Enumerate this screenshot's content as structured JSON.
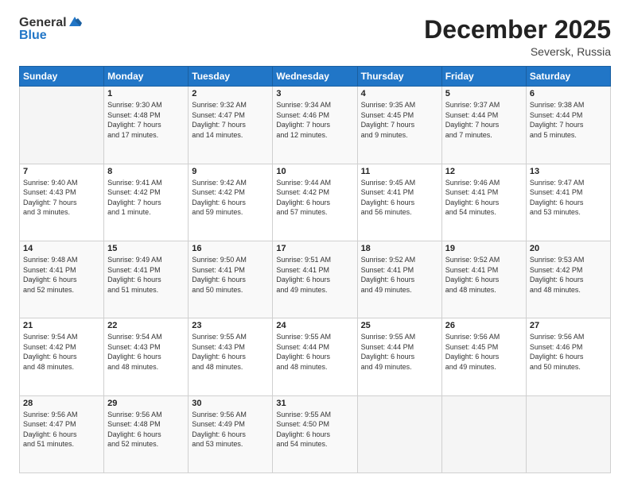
{
  "header": {
    "logo_general": "General",
    "logo_blue": "Blue",
    "month_title": "December 2025",
    "location": "Seversk, Russia"
  },
  "days_of_week": [
    "Sunday",
    "Monday",
    "Tuesday",
    "Wednesday",
    "Thursday",
    "Friday",
    "Saturday"
  ],
  "weeks": [
    [
      {
        "day": "",
        "sunrise": "",
        "sunset": "",
        "daylight": ""
      },
      {
        "day": "1",
        "sunrise": "Sunrise: 9:30 AM",
        "sunset": "Sunset: 4:48 PM",
        "daylight": "Daylight: 7 hours and 17 minutes."
      },
      {
        "day": "2",
        "sunrise": "Sunrise: 9:32 AM",
        "sunset": "Sunset: 4:47 PM",
        "daylight": "Daylight: 7 hours and 14 minutes."
      },
      {
        "day": "3",
        "sunrise": "Sunrise: 9:34 AM",
        "sunset": "Sunset: 4:46 PM",
        "daylight": "Daylight: 7 hours and 12 minutes."
      },
      {
        "day": "4",
        "sunrise": "Sunrise: 9:35 AM",
        "sunset": "Sunset: 4:45 PM",
        "daylight": "Daylight: 7 hours and 9 minutes."
      },
      {
        "day": "5",
        "sunrise": "Sunrise: 9:37 AM",
        "sunset": "Sunset: 4:44 PM",
        "daylight": "Daylight: 7 hours and 7 minutes."
      },
      {
        "day": "6",
        "sunrise": "Sunrise: 9:38 AM",
        "sunset": "Sunset: 4:44 PM",
        "daylight": "Daylight: 7 hours and 5 minutes."
      }
    ],
    [
      {
        "day": "7",
        "sunrise": "Sunrise: 9:40 AM",
        "sunset": "Sunset: 4:43 PM",
        "daylight": "Daylight: 7 hours and 3 minutes."
      },
      {
        "day": "8",
        "sunrise": "Sunrise: 9:41 AM",
        "sunset": "Sunset: 4:42 PM",
        "daylight": "Daylight: 7 hours and 1 minute."
      },
      {
        "day": "9",
        "sunrise": "Sunrise: 9:42 AM",
        "sunset": "Sunset: 4:42 PM",
        "daylight": "Daylight: 6 hours and 59 minutes."
      },
      {
        "day": "10",
        "sunrise": "Sunrise: 9:44 AM",
        "sunset": "Sunset: 4:42 PM",
        "daylight": "Daylight: 6 hours and 57 minutes."
      },
      {
        "day": "11",
        "sunrise": "Sunrise: 9:45 AM",
        "sunset": "Sunset: 4:41 PM",
        "daylight": "Daylight: 6 hours and 56 minutes."
      },
      {
        "day": "12",
        "sunrise": "Sunrise: 9:46 AM",
        "sunset": "Sunset: 4:41 PM",
        "daylight": "Daylight: 6 hours and 54 minutes."
      },
      {
        "day": "13",
        "sunrise": "Sunrise: 9:47 AM",
        "sunset": "Sunset: 4:41 PM",
        "daylight": "Daylight: 6 hours and 53 minutes."
      }
    ],
    [
      {
        "day": "14",
        "sunrise": "Sunrise: 9:48 AM",
        "sunset": "Sunset: 4:41 PM",
        "daylight": "Daylight: 6 hours and 52 minutes."
      },
      {
        "day": "15",
        "sunrise": "Sunrise: 9:49 AM",
        "sunset": "Sunset: 4:41 PM",
        "daylight": "Daylight: 6 hours and 51 minutes."
      },
      {
        "day": "16",
        "sunrise": "Sunrise: 9:50 AM",
        "sunset": "Sunset: 4:41 PM",
        "daylight": "Daylight: 6 hours and 50 minutes."
      },
      {
        "day": "17",
        "sunrise": "Sunrise: 9:51 AM",
        "sunset": "Sunset: 4:41 PM",
        "daylight": "Daylight: 6 hours and 49 minutes."
      },
      {
        "day": "18",
        "sunrise": "Sunrise: 9:52 AM",
        "sunset": "Sunset: 4:41 PM",
        "daylight": "Daylight: 6 hours and 49 minutes."
      },
      {
        "day": "19",
        "sunrise": "Sunrise: 9:52 AM",
        "sunset": "Sunset: 4:41 PM",
        "daylight": "Daylight: 6 hours and 48 minutes."
      },
      {
        "day": "20",
        "sunrise": "Sunrise: 9:53 AM",
        "sunset": "Sunset: 4:42 PM",
        "daylight": "Daylight: 6 hours and 48 minutes."
      }
    ],
    [
      {
        "day": "21",
        "sunrise": "Sunrise: 9:54 AM",
        "sunset": "Sunset: 4:42 PM",
        "daylight": "Daylight: 6 hours and 48 minutes."
      },
      {
        "day": "22",
        "sunrise": "Sunrise: 9:54 AM",
        "sunset": "Sunset: 4:43 PM",
        "daylight": "Daylight: 6 hours and 48 minutes."
      },
      {
        "day": "23",
        "sunrise": "Sunrise: 9:55 AM",
        "sunset": "Sunset: 4:43 PM",
        "daylight": "Daylight: 6 hours and 48 minutes."
      },
      {
        "day": "24",
        "sunrise": "Sunrise: 9:55 AM",
        "sunset": "Sunset: 4:44 PM",
        "daylight": "Daylight: 6 hours and 48 minutes."
      },
      {
        "day": "25",
        "sunrise": "Sunrise: 9:55 AM",
        "sunset": "Sunset: 4:44 PM",
        "daylight": "Daylight: 6 hours and 49 minutes."
      },
      {
        "day": "26",
        "sunrise": "Sunrise: 9:56 AM",
        "sunset": "Sunset: 4:45 PM",
        "daylight": "Daylight: 6 hours and 49 minutes."
      },
      {
        "day": "27",
        "sunrise": "Sunrise: 9:56 AM",
        "sunset": "Sunset: 4:46 PM",
        "daylight": "Daylight: 6 hours and 50 minutes."
      }
    ],
    [
      {
        "day": "28",
        "sunrise": "Sunrise: 9:56 AM",
        "sunset": "Sunset: 4:47 PM",
        "daylight": "Daylight: 6 hours and 51 minutes."
      },
      {
        "day": "29",
        "sunrise": "Sunrise: 9:56 AM",
        "sunset": "Sunset: 4:48 PM",
        "daylight": "Daylight: 6 hours and 52 minutes."
      },
      {
        "day": "30",
        "sunrise": "Sunrise: 9:56 AM",
        "sunset": "Sunset: 4:49 PM",
        "daylight": "Daylight: 6 hours and 53 minutes."
      },
      {
        "day": "31",
        "sunrise": "Sunrise: 9:55 AM",
        "sunset": "Sunset: 4:50 PM",
        "daylight": "Daylight: 6 hours and 54 minutes."
      },
      {
        "day": "",
        "sunrise": "",
        "sunset": "",
        "daylight": ""
      },
      {
        "day": "",
        "sunrise": "",
        "sunset": "",
        "daylight": ""
      },
      {
        "day": "",
        "sunrise": "",
        "sunset": "",
        "daylight": ""
      }
    ]
  ]
}
